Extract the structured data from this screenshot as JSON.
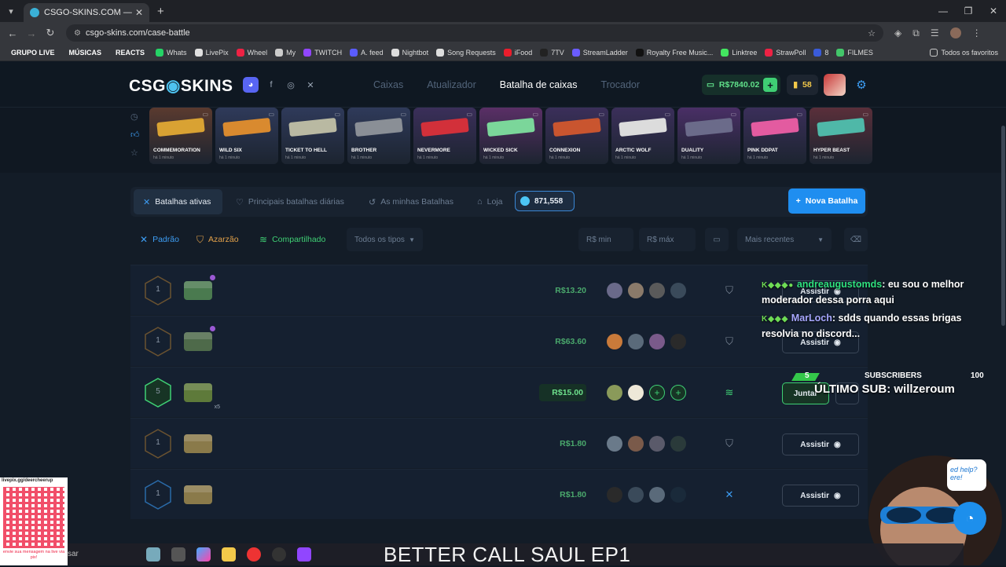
{
  "browser": {
    "tab_title": "CSGO-SKINS.COM — As melho",
    "url": "csgo-skins.com/case-battle",
    "bookmarks": [
      {
        "label": "GRUPO LIVE",
        "color": "#6a9a2f",
        "tag": true
      },
      {
        "label": "MÚSICAS",
        "color": "#6a9a2f",
        "tag": true
      },
      {
        "label": "REACTS",
        "color": "#6a9a2f",
        "tag": true
      },
      {
        "label": "Whats",
        "color": "#25d366"
      },
      {
        "label": "LivePix",
        "color": "#e0e0e0"
      },
      {
        "label": "Wheel",
        "color": "#e24"
      },
      {
        "label": "My",
        "color": "#ccc"
      },
      {
        "label": "TWITCH",
        "color": "#9146ff"
      },
      {
        "label": "A. feed",
        "color": "#5a5cff"
      },
      {
        "label": "Nightbot",
        "color": "#ddd"
      },
      {
        "label": "Song Requests",
        "color": "#ddd"
      },
      {
        "label": "iFood",
        "color": "#ea1d2c"
      },
      {
        "label": "7TV",
        "color": "#222"
      },
      {
        "label": "StreamLadder",
        "color": "#6a5cff"
      },
      {
        "label": "Royalty Free Music...",
        "color": "#111"
      },
      {
        "label": "Linktree",
        "color": "#43e660"
      },
      {
        "label": "StrawPoll",
        "color": "#e24"
      },
      {
        "label": "8",
        "color": "#3a5bd9"
      },
      {
        "label": "FILMES",
        "color": "#43c66a"
      }
    ],
    "bookmarks_right": "Todos os favoritos"
  },
  "site": {
    "logo_left": "CSG",
    "logo_right": "SKINS",
    "nav": [
      "Caixas",
      "Atualizador",
      "Batalha de caixas",
      "Trocador"
    ],
    "active_nav": "Batalha de caixas",
    "balance": "R$7840.02",
    "coins": "58",
    "live_drops": [
      {
        "name": "COMMEMORATION",
        "time": "há 1 minuto",
        "bg": "#5a3a2f",
        "gun": "#d9a233"
      },
      {
        "name": "WILD SIX",
        "time": "há 1 minuto",
        "bg": "#2f3a5a",
        "gun": "#d98a2f"
      },
      {
        "name": "TICKET TO HELL",
        "time": "há 1 minuto",
        "bg": "#2f3a5a",
        "gun": "#b9b9a2"
      },
      {
        "name": "BROTHER",
        "time": "há 1 minuto",
        "bg": "#2f3a5a",
        "gun": "#8a8f96"
      },
      {
        "name": "NEVERMORE",
        "time": "há 1 minuto",
        "bg": "#3b2f5a",
        "gun": "#d2303a"
      },
      {
        "name": "WICKED SICK",
        "time": "há 1 minuto",
        "bg": "#5a2f66",
        "gun": "#7bd69a"
      },
      {
        "name": "CONNEXION",
        "time": "há 1 minuto",
        "bg": "#3b2f5a",
        "gun": "#c9552f"
      },
      {
        "name": "ARCTIC WOLF",
        "time": "há 1 minuto",
        "bg": "#3b2f5a",
        "gun": "#dcdcdc"
      },
      {
        "name": "DUALITY",
        "time": "há 1 minuto",
        "bg": "#4a2f66",
        "gun": "#6b6b8a"
      },
      {
        "name": "PINK DDPAT",
        "time": "há 1 minuto",
        "bg": "#3b2f5a",
        "gun": "#e35ba0"
      },
      {
        "name": "HYPER BEAST",
        "time": "há 1 minuto",
        "bg": "#5a2f3a",
        "gun": "#4fb8a8"
      }
    ],
    "filters": {
      "tabs": [
        "Batalhas ativas",
        "Principais batalhas diárias",
        "As minhas Batalhas",
        "Loja"
      ],
      "gems": "871,558",
      "new_battle": "Nova Batalha"
    },
    "modes": {
      "padrao": "Padrão",
      "azarzao": "Azarzão",
      "compartilhado": "Compartilhado",
      "type_select": "Todos os tipos",
      "min_placeholder": "R$ min",
      "max_placeholder": "R$ máx",
      "sort_select": "Mais recentes"
    },
    "battles": [
      {
        "rounds": "1",
        "price": "R$13.20",
        "action": "Assistir",
        "case_color": "#4a7a4f",
        "players": [
          "#6a6a8a",
          "#8a7a6a",
          "#5a5a5a",
          "#3a4a5a"
        ],
        "mode": "shield",
        "dot": true
      },
      {
        "rounds": "1",
        "price": "R$63.60",
        "action": "Assistir",
        "case_color": "#4e6a4a",
        "players": [
          "#c97a3a",
          "#5a6a7a",
          "#7a5a8a",
          "#2a2a2a"
        ],
        "mode": "shield",
        "dot": true
      },
      {
        "rounds": "5",
        "price": "R$15.00",
        "action": "Juntar",
        "case_color": "#5e7a3a",
        "players": [
          "#8a9a5a",
          "#eee8d8",
          "add",
          "add"
        ],
        "mode": "shared",
        "mult": "x5",
        "highlight": true
      },
      {
        "rounds": "1",
        "price": "R$1.80",
        "action": "Assistir",
        "case_color": "#8a7a4a",
        "players": [
          "#6a7a8a",
          "#7a5a4a",
          "#5a5a6a",
          "#2a3a3a"
        ],
        "mode": "shield"
      },
      {
        "rounds": "1",
        "price": "R$1.80",
        "action": "Assistir",
        "case_color": "#8a7a4a",
        "players": [
          "#2a2a2a",
          "#3a4a5a",
          "#5a6a7a",
          "#1a2a3a"
        ],
        "mode": "cross"
      }
    ]
  },
  "overlay": {
    "chat": [
      {
        "user": "andreaugustomds",
        "text": ": eu sou o melhor moderador dessa porra aqui"
      },
      {
        "user": "MarLoch",
        "text": ": sdds quando essas brigas resolvia no discord..."
      }
    ],
    "subs_current": "5",
    "subs_label": "SUBSCRIBERS",
    "subs_goal": "100",
    "last_sub": "ÚLTIMO SUB: willzeroum",
    "help_text": "ed help? ere!",
    "qr_top": "livepix.gg/deercheerup",
    "qr_bottom": "envie sua mensagem na live via pix!",
    "taskbar_search": "sar",
    "ticker": "BETTER CALL SAUL EP1"
  }
}
